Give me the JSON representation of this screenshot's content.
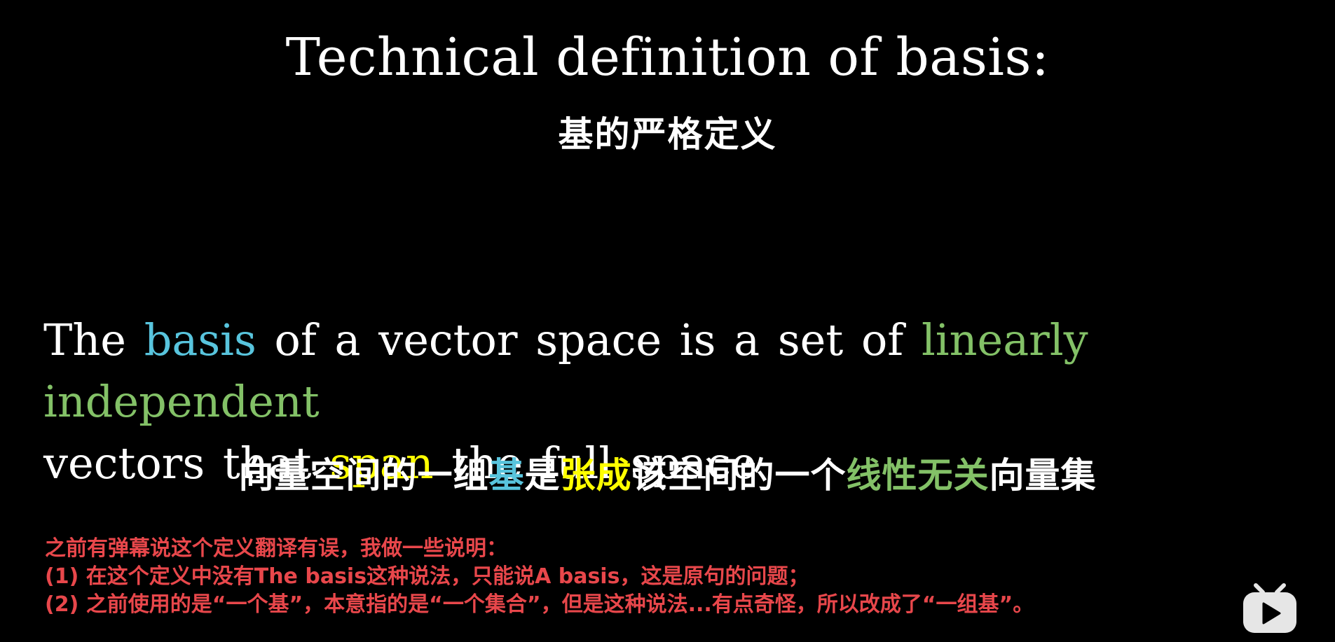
{
  "slide": {
    "title": "Technical definition of basis:",
    "subtitle_cn": "基的严格定义",
    "definition": {
      "line1": {
        "part1": "The ",
        "basis": "basis",
        "part2": " of a vector space is a set of ",
        "linearly_independent": "linearly independent"
      },
      "line2": {
        "part1": "vectors that ",
        "span": "span",
        "part2": " the full space"
      }
    },
    "definition_cn": {
      "part1": "向量空间的一组",
      "ji": "基",
      "part2": "是",
      "zhangcheng": "张成",
      "part3": "该空间的一个",
      "xianxingwuguan": "线性无关",
      "part4": "向量集"
    },
    "note": {
      "line1": "之前有弹幕说这个定义翻译有误，我做一些说明：",
      "line2": "(1) 在这个定义中没有The basis这种说法，只能说A basis，这是原句的问题；",
      "line3": "(2) 之前使用的是“一个基”，本意指的是“一个集合”，但是这种说法...有点奇怪，所以改成了“一组基”。"
    }
  },
  "colors": {
    "background": "#000000",
    "text": "#ffffff",
    "basis_blue": "#58c4dd",
    "independent_green": "#83c167",
    "span_yellow": "#ffff00",
    "note_red": "#e8474b"
  },
  "icons": {
    "logo": "bilibili-tv-play-icon"
  }
}
